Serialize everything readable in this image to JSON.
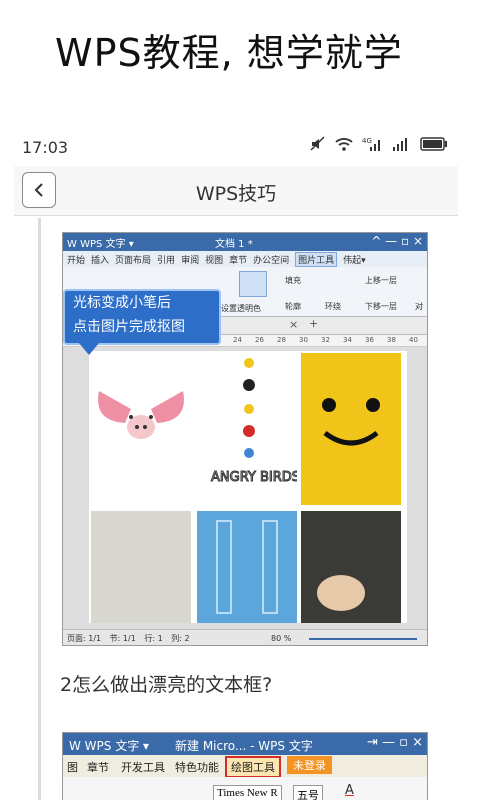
{
  "banner": {
    "title": "WPS教程, 想学就学"
  },
  "status": {
    "time": "17:03",
    "network": "4G"
  },
  "nav": {
    "title": "WPS技巧"
  },
  "shot1": {
    "app": "W WPS 文字 ▾",
    "doc": "文档 1 *",
    "menu": [
      "开始",
      "插入",
      "页面布局",
      "引用",
      "审阅",
      "视图",
      "章节",
      "办公空间",
      "图片工具",
      "伟起▾"
    ],
    "active_menu": "图片工具",
    "ribbon": {
      "set_transparent": "设置透明色",
      "fill": "填充",
      "outline": "轮廓",
      "wrap": "环绕",
      "up": "上移一层",
      "down": "下移一层",
      "align": "对"
    },
    "callout": {
      "line1": "光标变成小笔后",
      "line2": "点击图片完成抠图"
    },
    "doc_tab_close": "×",
    "doc_tab_add": "+",
    "ruler_ticks": [
      "24",
      "26",
      "28",
      "30",
      "32",
      "34",
      "36",
      "38",
      "40"
    ],
    "angry_birds": "ANGRY BIRDS",
    "statusbar": {
      "page": "页面: 1/1",
      "section": "节: 1/1",
      "row": "行: 1",
      "col": "列: 2",
      "zoom": "80 %"
    }
  },
  "question": "2怎么做出漂亮的文本框?",
  "shot2": {
    "app": "W WPS 文字 ▾",
    "doc": "新建 Micro... - WPS 文字",
    "menu": [
      "图",
      "章节",
      "开发工具",
      "特色功能",
      "绘图工具",
      "未登录"
    ],
    "highlighted": "绘图工具",
    "font": "Times New R",
    "size": "五号",
    "font_color_label": "A"
  }
}
